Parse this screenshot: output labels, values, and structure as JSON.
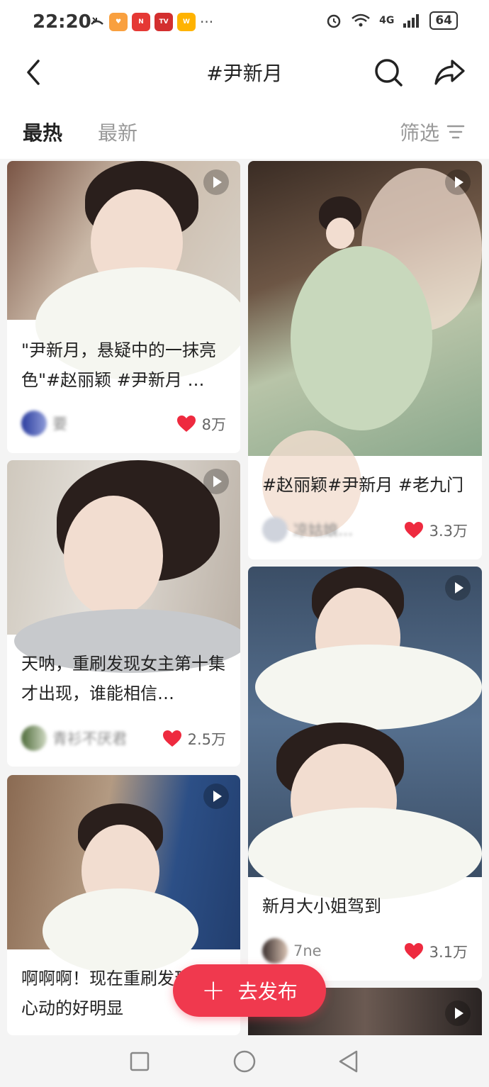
{
  "status_bar": {
    "time": "22:20",
    "network": "4G",
    "battery": "64"
  },
  "header": {
    "title": "#尹新月"
  },
  "tabs": {
    "hot": "最热",
    "latest": "最新",
    "filter": "筛选"
  },
  "posts": [
    {
      "caption": "\"尹新月，悬疑中的一抹亮色\"#赵丽颖 #尹新月 …",
      "author": "要",
      "likes": "8万"
    },
    {
      "caption": "#赵丽颖#尹新月 #老九门",
      "author": "凉姑娘…",
      "likes": "3.3万"
    },
    {
      "caption": "天呐，重刷发现女主第十集才出现，谁能相信…",
      "author": "青衫不厌君",
      "likes": "2.5万"
    },
    {
      "caption": "新月大小姐驾到",
      "author": "7ne",
      "likes": "3.1万"
    },
    {
      "caption": "啊啊啊！现在重刷发现这里心动的好明显",
      "author": "",
      "likes": ""
    }
  ],
  "fab": {
    "label": "去发布"
  },
  "colors": {
    "accent": "#f0394e",
    "like": "#ee2a3f"
  }
}
